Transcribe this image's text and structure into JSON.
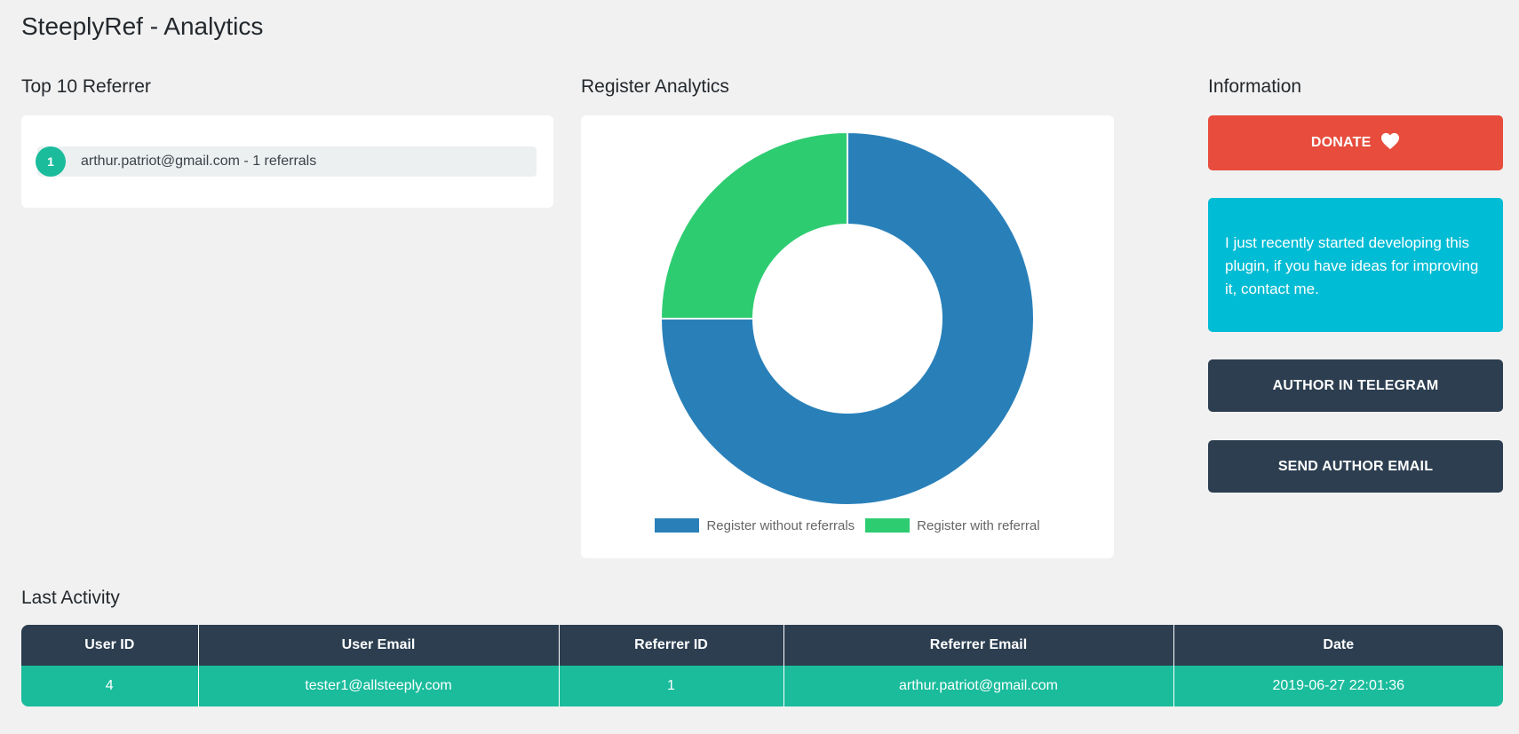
{
  "page_title": "SteeplyRef - Analytics",
  "sections": {
    "top_referrer": "Top 10 Referrer",
    "register_analytics": "Register Analytics",
    "information": "Information",
    "last_activity": "Last Activity"
  },
  "top_referrers": [
    {
      "rank": "1",
      "text": "arthur.patriot@gmail.com - 1 referrals"
    }
  ],
  "chart_data": {
    "type": "pie",
    "variant": "doughnut",
    "categories": [
      "Register without referrals",
      "Register with referral"
    ],
    "values": [
      3,
      1
    ],
    "colors": [
      "#2980b9",
      "#2ecc71"
    ],
    "legend_position": "bottom"
  },
  "information": {
    "donate_label": "DONATE",
    "donate_icon": "heart-icon",
    "message": "I just recently started developing this plugin, if you have ideas for improving it, contact me.",
    "telegram_label": "AUTHOR IN TELEGRAM",
    "email_label": "SEND AUTHOR EMAIL"
  },
  "last_activity": {
    "columns": [
      "User ID",
      "User Email",
      "Referrer ID",
      "Referrer Email",
      "Date"
    ],
    "rows": [
      [
        "4",
        "tester1@allsteeply.com",
        "1",
        "arthur.patriot@gmail.com",
        "2019-06-27 22:01:36"
      ]
    ]
  },
  "colors": {
    "background": "#f1f1f1",
    "accent_green": "#1abc9c",
    "dark": "#2c3e50",
    "donate_red": "#e74c3c",
    "info_cyan": "#00bcd4"
  }
}
